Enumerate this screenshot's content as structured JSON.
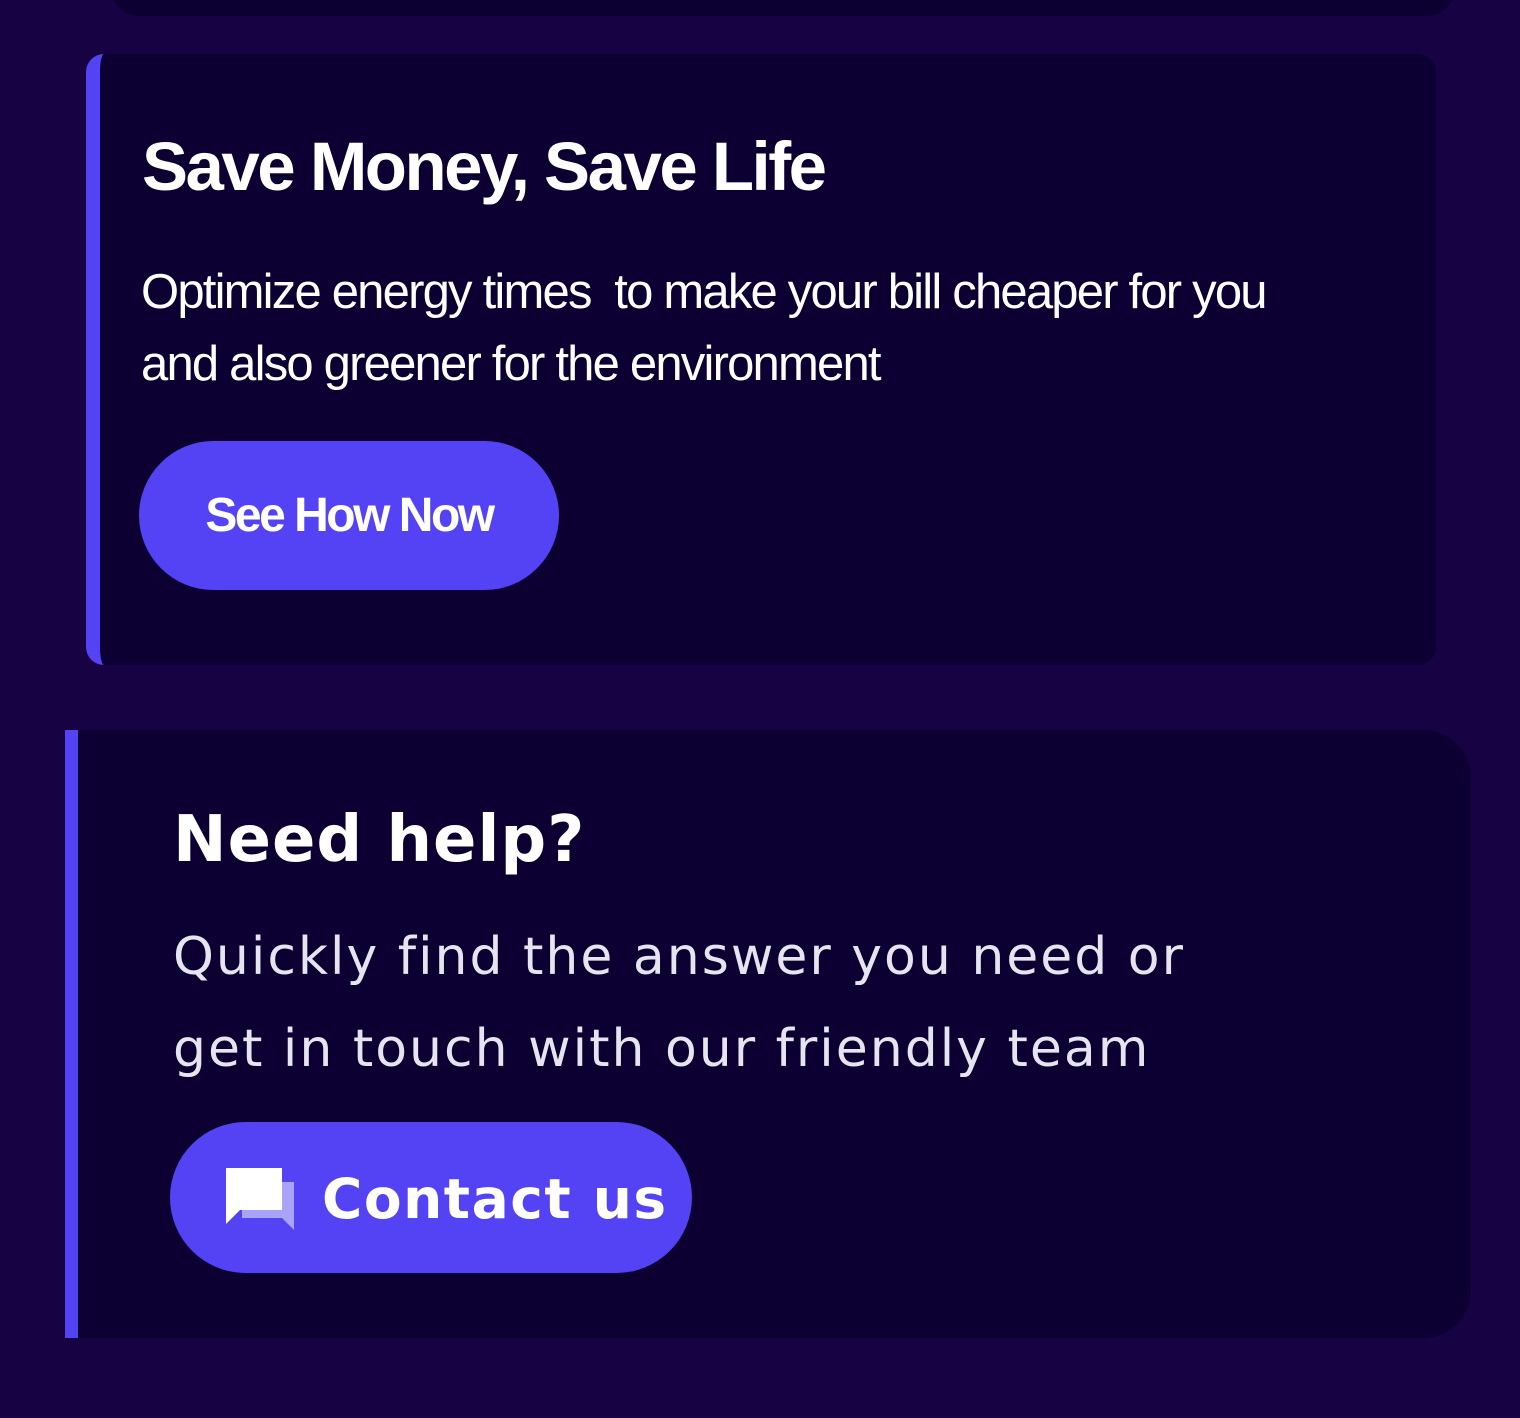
{
  "colors": {
    "page_background": "#170244",
    "card_background": "#0c0032",
    "accent": "#5443f5",
    "text": "#ffffff"
  },
  "promo_card": {
    "title": "Save Money, Save Life",
    "description": "Optimize energy times  to make your bill cheaper for you\nand also greener for the environment",
    "button_label": "See How Now"
  },
  "help_card": {
    "title": "Need help?",
    "description_lines": [
      "Quickly find the answer you need or",
      "get in touch with our friendly team"
    ],
    "button_label": "Contact us",
    "button_icon": "chat-icon"
  }
}
